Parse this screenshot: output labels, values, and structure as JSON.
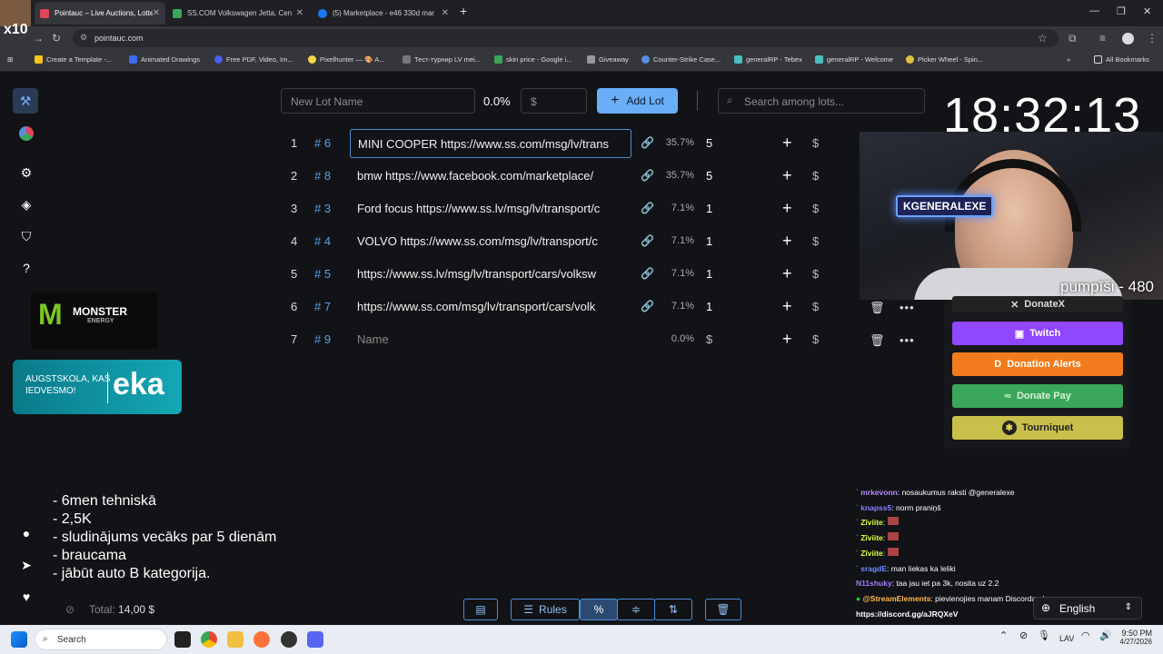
{
  "browser": {
    "tabs": [
      {
        "title": "Pointauc – Live Auctions, Lotter",
        "active": true
      },
      {
        "title": "SS.COM Volkswagen Jetta, Cen",
        "active": false
      },
      {
        "title": "(5) Marketplace - e46 330d mar",
        "active": false
      }
    ],
    "url": "pointauc.com",
    "bookmarks": [
      "Create a Template -...",
      "Animated Drawings",
      "Free PDF, Video, Im...",
      "Pixelhunter — 🎨 A...",
      "Тест-турнир LV mei...",
      "skin price - Google i...",
      "Giveaway",
      "Counter-Strike Case...",
      "generalRP - Tebex",
      "generalRP - Welcome",
      "Picker Wheel - Spin...",
      "All Bookmarks"
    ],
    "overlay_badge": "x10"
  },
  "toolbar": {
    "lot_name_placeholder": "New Lot Name",
    "percent": "0.0%",
    "amount_placeholder": "$",
    "add_lot_label": "Add Lot",
    "search_placeholder": "Search among lots..."
  },
  "clock": "18:32:13",
  "lots": [
    {
      "index": "1",
      "id": "# 6",
      "name": "MINI COOPER https://www.ss.com/msg/lv/trans",
      "percent": "35.7%",
      "amount": "5"
    },
    {
      "index": "2",
      "id": "# 8",
      "name": "bmw  https://www.facebook.com/marketplace/",
      "percent": "35.7%",
      "amount": "5"
    },
    {
      "index": "3",
      "id": "# 3",
      "name": "Ford focus https://www.ss.lv/msg/lv/transport/c",
      "percent": "7.1%",
      "amount": "1"
    },
    {
      "index": "4",
      "id": "# 4",
      "name": "VOLVO https://www.ss.com/msg/lv/transport/c",
      "percent": "7.1%",
      "amount": "1"
    },
    {
      "index": "5",
      "id": "# 5",
      "name": "https://www.ss.lv/msg/lv/transport/cars/volksw",
      "percent": "7.1%",
      "amount": "1"
    },
    {
      "index": "6",
      "id": "# 7",
      "name": "https://www.ss.com/msg/lv/transport/cars/volk",
      "percent": "7.1%",
      "amount": "1"
    },
    {
      "index": "7",
      "id": "# 9",
      "name": "Name",
      "percent": "0.0%",
      "amount": "$"
    }
  ],
  "webcam": {
    "neon_sign": "KGENERALEXE",
    "overlay_text": "pumpīši - 480"
  },
  "donations": {
    "donatex": "DonateX",
    "twitch": "Twitch",
    "donation_alerts": "Donation Alerts",
    "donate_pay": "Donate Pay",
    "tourniquet": "Tourniquet",
    "colors": {
      "twitch": "#9146ff",
      "alerts": "#f07c1e",
      "pay": "#3aa75a",
      "tourniquet": "#c8c04a"
    }
  },
  "sponsors": {
    "monster": "MONSTER",
    "monster_sub": "ENERGY",
    "eka_line1": "AUGSTSKOLA, KAS",
    "eka_line2": "IEDVESMO!",
    "eka_logo": "eka"
  },
  "notes": [
    "- 6men tehniskā",
    "- 2,5K",
    "- sludinājums vecāks par 5 dienām",
    "- braucama",
    "- jābūt auto B kategorija."
  ],
  "total_label": "Total:",
  "total_value": "14,00 $",
  "bottom_toolbar": {
    "rules": "Rules"
  },
  "chat": [
    {
      "user": "mrkevonn",
      "msg": ": nosaukumus raksti @generalexe",
      "color": "#b48cff"
    },
    {
      "user": "knapss5",
      "msg": ": norm praniņš",
      "color": "#8a7cff"
    },
    {
      "user": "Zīviite",
      "msg": ":",
      "color": "#d8ff3a"
    },
    {
      "user": "Zīviite",
      "msg": ":",
      "color": "#d8ff3a"
    },
    {
      "user": "Zīviite",
      "msg": ":",
      "color": "#d8ff3a"
    },
    {
      "user": "sragdE",
      "msg": ": man liekas ka leliki",
      "color": "#6b8cff"
    },
    {
      "user": "N11shuky",
      "msg": ": taa jau iet pa 3k, nosita uz 2.2",
      "color": "#a47cff"
    },
    {
      "user": "@StreamElements",
      "msg": ": pievienojies manam Discordam!",
      "color": "#ffb84a"
    },
    {
      "user": "",
      "msg": "https://discord.gg/aJRQXeV",
      "color": "#ffffff"
    }
  ],
  "language": "English",
  "taskbar": {
    "search": "Search",
    "lang": "LAV",
    "time": "9:50 PM",
    "date": "4/27/2026"
  }
}
